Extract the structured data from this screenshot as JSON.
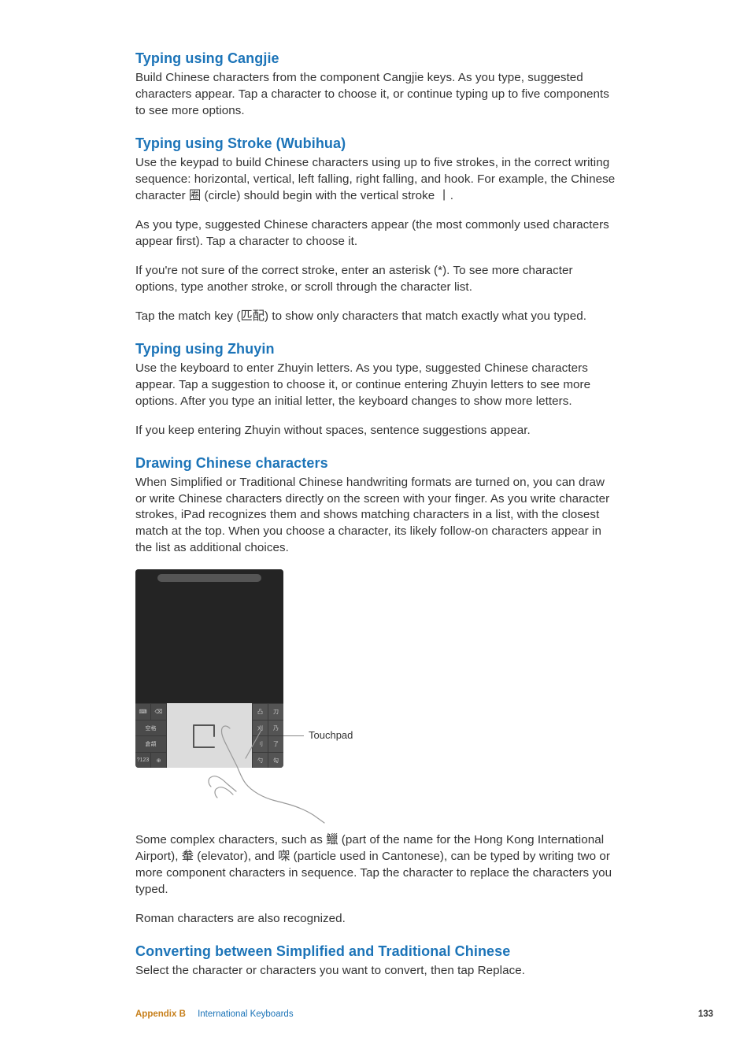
{
  "sections": {
    "cangjie": {
      "heading": "Typing using Cangjie",
      "p1": "Build Chinese characters from the component Cangjie keys. As you type, suggested characters appear. Tap a character to choose it, or continue typing up to five components to see more options."
    },
    "stroke": {
      "heading": "Typing using Stroke (Wubihua)",
      "p1": "Use the keypad to build Chinese characters using up to five strokes, in the correct writing sequence: horizontal, vertical, left falling, right falling, and hook. For example, the Chinese character 圈 (circle) should begin with the vertical stroke 丨.",
      "p2": "As you type, suggested Chinese characters appear (the most commonly used characters appear first). Tap a character to choose it.",
      "p3": "If you're not sure of the correct stroke, enter an asterisk (*). To see more character options, type another stroke, or scroll through the character list.",
      "p4": "Tap the match key (匹配) to show only characters that match exactly what you typed."
    },
    "zhuyin": {
      "heading": "Typing using Zhuyin",
      "p1": "Use the keyboard to enter Zhuyin letters. As you type, suggested Chinese characters appear. Tap a suggestion to choose it, or continue entering Zhuyin letters to see more options. After you type an initial letter, the keyboard changes to show more letters.",
      "p2": "If you keep entering Zhuyin without spaces, sentence suggestions appear."
    },
    "drawing": {
      "heading": "Drawing Chinese characters",
      "p1": "When Simplified or Traditional Chinese handwriting formats are turned on, you can draw or write Chinese characters directly on the screen with your finger. As you write character strokes, iPad recognizes them and shows matching characters in a list, with the closest match at the top. When you choose a character, its likely follow-on characters appear in the list as additional choices.",
      "callout": "Touchpad",
      "p2": "Some complex characters, such as 鱲 (part of the name for the Hong Kong International Airport), 軬 (elevator), and 㗎 (particle used in Cantonese), can be typed by writing two or more component characters in sequence. Tap the character to replace the characters you typed.",
      "p3": "Roman characters are also recognized."
    },
    "converting": {
      "heading": "Converting between Simplified and Traditional Chinese",
      "p1": "Select the character or characters you want to convert, then tap Replace."
    }
  },
  "keypad": {
    "left": [
      [
        "⌨",
        "⌫"
      ],
      [
        "空格",
        ""
      ],
      [
        "倉頡",
        ""
      ],
      [
        "?123",
        "⊕"
      ]
    ],
    "right": [
      [
        "凸",
        "刀"
      ],
      [
        "刈",
        "乃"
      ],
      [
        "刂",
        "了"
      ],
      [
        "勺",
        "勾"
      ]
    ]
  },
  "footer": {
    "appendix": "Appendix B",
    "title": "International Keyboards",
    "page": "133"
  }
}
